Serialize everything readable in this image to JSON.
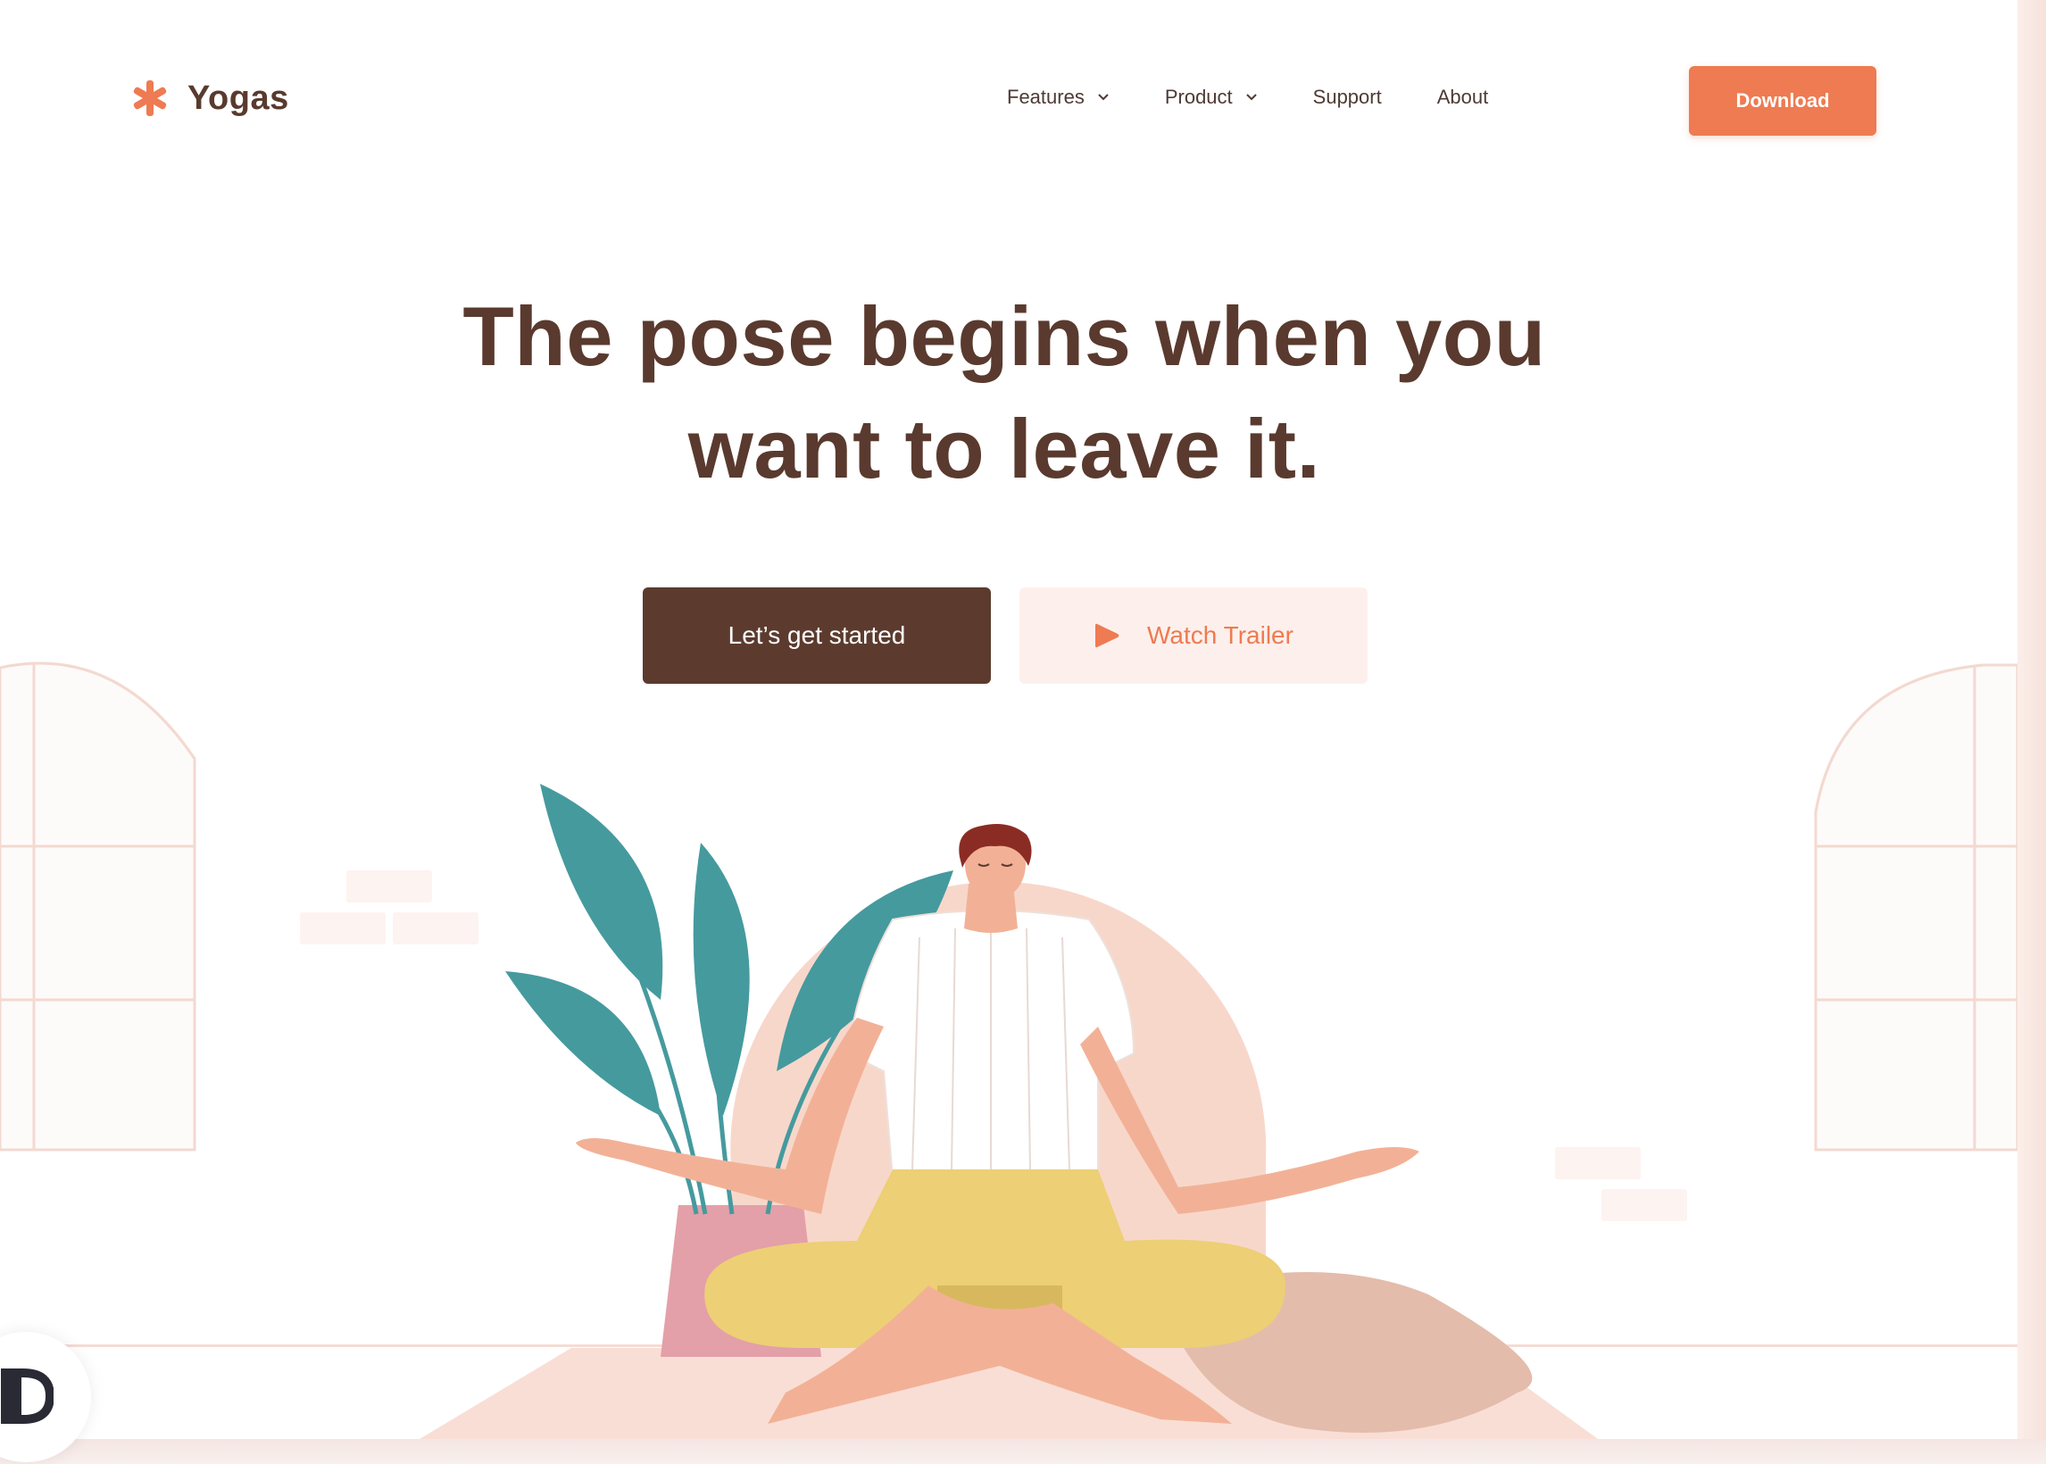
{
  "brand": {
    "name": "Yogas",
    "icon": "asterisk-icon",
    "color": "#ee7b52"
  },
  "nav": {
    "items": [
      {
        "label": "Features",
        "dropdown": true
      },
      {
        "label": "Product",
        "dropdown": true
      },
      {
        "label": "Support",
        "dropdown": false
      },
      {
        "label": "About",
        "dropdown": false
      }
    ],
    "cta_label": "Download"
  },
  "hero": {
    "headline_line1": "The pose begins when you",
    "headline_line2": "want to leave it.",
    "primary_label": "Let’s get started",
    "secondary_label": "Watch Trailer",
    "secondary_icon": "play-icon"
  },
  "colors": {
    "accent": "#ee7b52",
    "dark_brown": "#5c3b2e",
    "plant_teal": "#459a9e",
    "pants_yellow": "#edcf75",
    "skin": "#f2b196",
    "halo_pink": "#f8d7cb"
  }
}
